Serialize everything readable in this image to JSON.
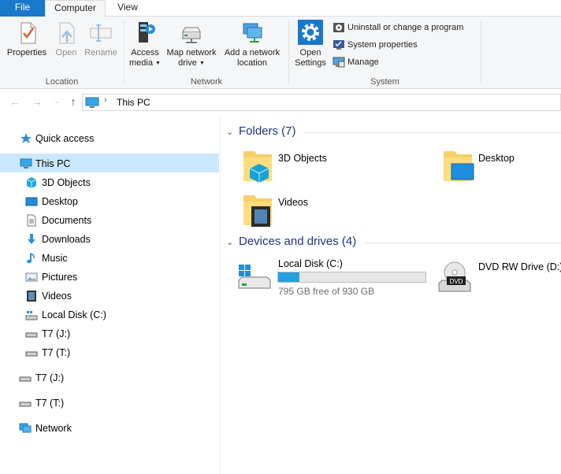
{
  "ribbon": {
    "tabs": [
      "File",
      "Computer",
      "View"
    ],
    "location": {
      "caption": "Location",
      "properties": "Properties",
      "open": "Open",
      "rename": "Rename"
    },
    "network": {
      "caption": "Network",
      "access_media_l1": "Access",
      "access_media_l2": "media",
      "map_drive_l1": "Map network",
      "map_drive_l2": "drive",
      "add_location_l1": "Add a network",
      "add_location_l2": "location"
    },
    "system": {
      "caption": "System",
      "open_settings_l1": "Open",
      "open_settings_l2": "Settings",
      "uninstall": "Uninstall or change a program",
      "system_properties": "System properties",
      "manage": "Manage"
    }
  },
  "address": {
    "crumb": "This PC"
  },
  "nav": {
    "quick_access": "Quick access",
    "this_pc": "This PC",
    "children": [
      "3D Objects",
      "Desktop",
      "Documents",
      "Downloads",
      "Music",
      "Pictures",
      "Videos",
      "Local Disk (C:)",
      "T7 (J:)",
      "T7 (T:)"
    ],
    "t7_j": "T7 (J:)",
    "t7_t": "T7 (T:)",
    "network": "Network"
  },
  "folders": {
    "header": "Folders (7)",
    "items": [
      "3D Objects",
      "Desktop",
      "Videos"
    ]
  },
  "devices": {
    "header": "Devices and drives (4)",
    "local_disk": {
      "name": "Local Disk (C:)",
      "free": "795 GB free of 930 GB",
      "used_fraction": 0.145
    },
    "dvd": {
      "name": "DVD RW Drive (D:)",
      "badge": "DVD"
    }
  },
  "colors": {
    "accent": "#1979ca",
    "selection": "#cce8ff",
    "group_header": "#1e3287",
    "bar_fill": "#26a0da"
  }
}
